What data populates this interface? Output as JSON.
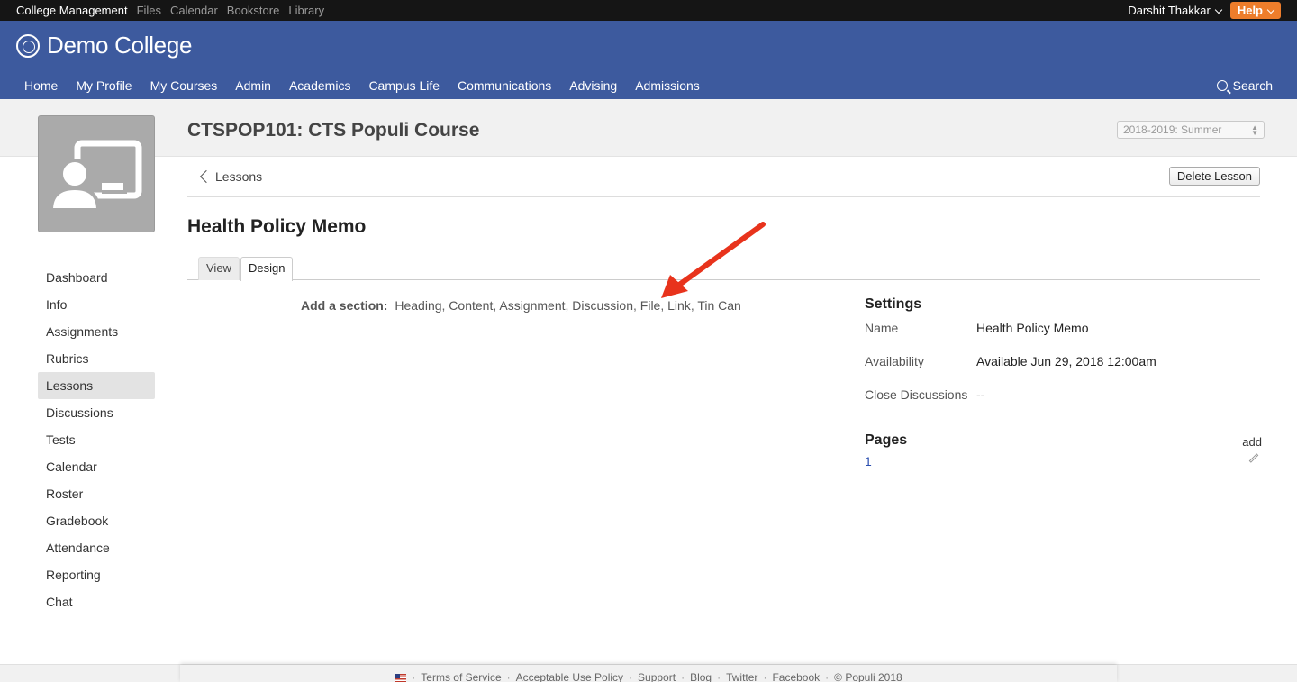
{
  "topbar": {
    "apps": [
      "College Management",
      "Files",
      "Calendar",
      "Bookstore",
      "Library"
    ],
    "user": "Darshit Thakkar",
    "help": "Help"
  },
  "header": {
    "brand": "Demo College",
    "nav": [
      "Home",
      "My Profile",
      "My Courses",
      "Admin",
      "Academics",
      "Campus Life",
      "Communications",
      "Advising",
      "Admissions"
    ],
    "search": "Search"
  },
  "course": {
    "title": "CTSPOP101: CTS Populi Course",
    "term": "2018-2019: Summer"
  },
  "sidebar": {
    "items": [
      "Dashboard",
      "Info",
      "Assignments",
      "Rubrics",
      "Lessons",
      "Discussions",
      "Tests",
      "Calendar",
      "Roster",
      "Gradebook",
      "Attendance",
      "Reporting",
      "Chat"
    ],
    "active": "Lessons"
  },
  "lesson": {
    "back_label": "Lessons",
    "delete_label": "Delete Lesson",
    "title": "Health Policy Memo",
    "tabs": [
      "View",
      "Design"
    ],
    "add_section_label": "Add a section:",
    "section_types": [
      "Heading",
      "Content",
      "Assignment",
      "Discussion",
      "File",
      "Link",
      "Tin Can"
    ]
  },
  "settings": {
    "title": "Settings",
    "rows": [
      {
        "key": "Name",
        "value": "Health Policy Memo"
      },
      {
        "key": "Availability",
        "value": "Available Jun 29, 2018 12:00am"
      },
      {
        "key": "Close Discussions",
        "value": "--"
      }
    ]
  },
  "pages": {
    "title": "Pages",
    "add_label": "add",
    "items": [
      "1"
    ]
  },
  "footer": {
    "links": [
      "Terms of Service",
      "Acceptable Use Policy",
      "Support",
      "Blog",
      "Twitter",
      "Facebook",
      "© Populi 2018"
    ]
  },
  "colors": {
    "header_blue": "#3d5a9e",
    "help_orange": "#ee7d2b",
    "annotation_arrow": "#e8331c",
    "link_blue": "#2b4fb0"
  }
}
